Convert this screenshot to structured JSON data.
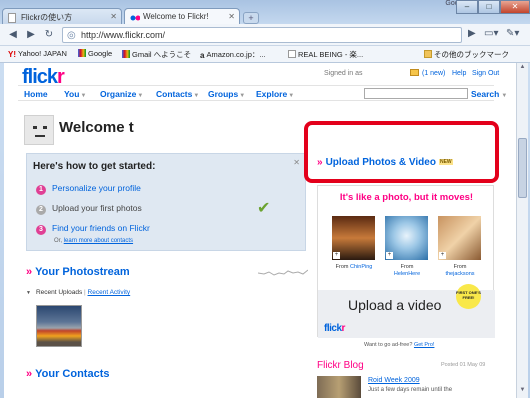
{
  "browser": {
    "tabs": [
      {
        "label": "Flickrの使い方",
        "active": false
      },
      {
        "label": "Welcome to Flickr!",
        "active": true
      }
    ],
    "window_label": "Google",
    "address": "http://www.flickr.com/",
    "bookmarks": [
      {
        "label": "Yahoo! JAPAN",
        "icon": "yahoo-favicon"
      },
      {
        "label": "Google",
        "icon": "google-favicon"
      },
      {
        "label": "Gmail へようこそ",
        "icon": "gmail-favicon"
      },
      {
        "label": "Amazon.co.jp：...",
        "icon": "amazon-favicon"
      },
      {
        "label": "REAL BEING - 楽...",
        "icon": "page-favicon"
      },
      {
        "label": "その他のブックマーク",
        "icon": "folder-icon"
      }
    ]
  },
  "flickr": {
    "logo": {
      "part1": "flick",
      "part2": "r"
    },
    "top": {
      "signed_in": "Signed in as",
      "mail": "(1 new)",
      "help": "Help",
      "signout": "Sign Out"
    },
    "nav": [
      "Home",
      "You",
      "Organize",
      "Contacts",
      "Groups",
      "Explore"
    ],
    "search_label": "Search",
    "welcome": "Welcome t",
    "get_started": {
      "heading": "Here's how to get started:",
      "steps": [
        {
          "num": "1",
          "text": "Personalize your profile",
          "done": false
        },
        {
          "num": "2",
          "text": "Upload your first photos",
          "done": true
        },
        {
          "num": "3",
          "text": "Find your friends on Flickr",
          "done": false
        }
      ],
      "sub_prefix": "Or,",
      "sub_link": "learn more about contacts"
    },
    "photostream": {
      "title": "Your Photostream",
      "recent": "Recent Uploads",
      "sep": "|",
      "activity": "Recent Activity"
    },
    "contacts_title": "Your Contacts",
    "upload": {
      "label": "Upload Photos & Video",
      "badge": "NEW"
    },
    "ad": {
      "tagline": "It's like a photo, but it moves!",
      "photos": [
        {
          "from": "From",
          "user": "ChinPing"
        },
        {
          "from": "From",
          "user": "HelenHere"
        },
        {
          "from": "From",
          "user": "thejacksons"
        }
      ],
      "headline": "Upload a video",
      "badge": "FIRST ONE'S FREE!",
      "logo": {
        "part1": "flick",
        "part2": "r"
      }
    },
    "adfree": {
      "prefix": "Want to go ad-free?",
      "link": "Get Pro!"
    },
    "blog": {
      "title": "Flickr Blog",
      "posted": "Posted 01 May 09",
      "post_title": "Roid Week 2009",
      "excerpt": "Just a few days remain until the"
    }
  },
  "colors": {
    "flickr_blue": "#0063dc",
    "flickr_pink": "#ff0084",
    "highlight_red": "#e3001b"
  }
}
